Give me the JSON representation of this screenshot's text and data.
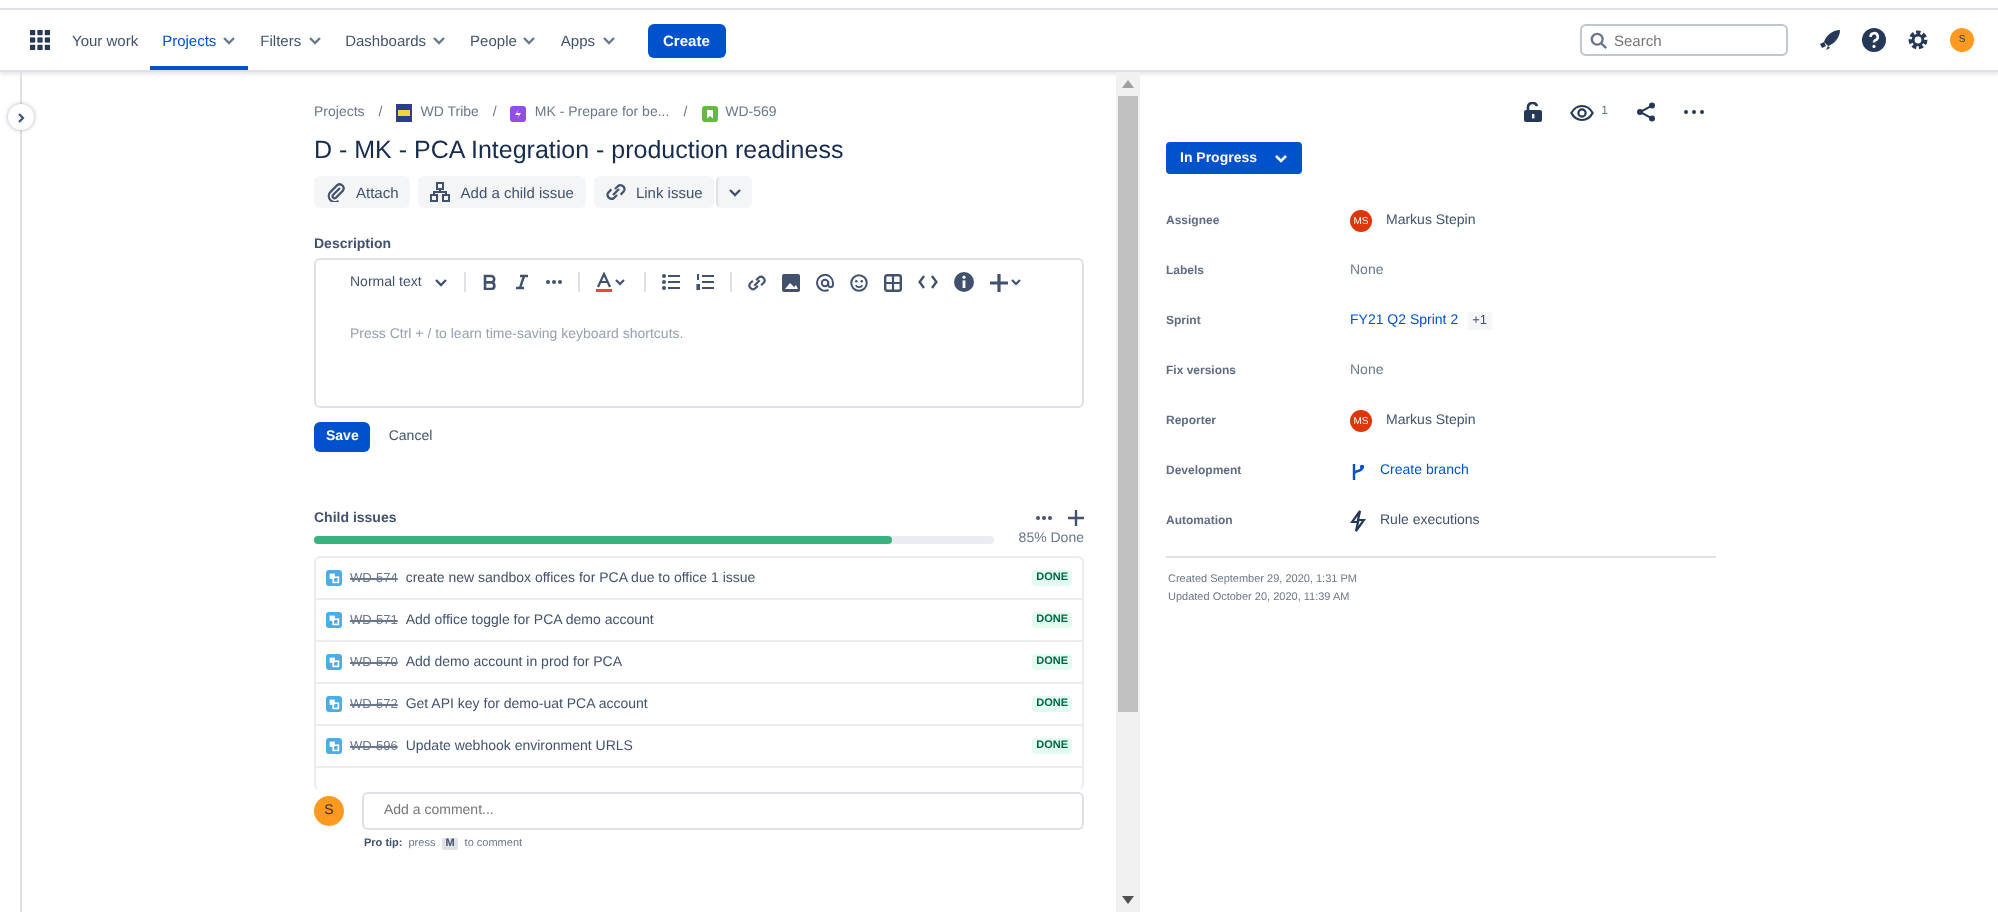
{
  "nav": {
    "items": [
      {
        "label": "Your work",
        "dropdown": false,
        "selected": false
      },
      {
        "label": "Projects",
        "dropdown": true,
        "selected": true
      },
      {
        "label": "Filters",
        "dropdown": true,
        "selected": false
      },
      {
        "label": "Dashboards",
        "dropdown": true,
        "selected": false
      },
      {
        "label": "People",
        "dropdown": true,
        "selected": false
      },
      {
        "label": "Apps",
        "dropdown": true,
        "selected": false
      }
    ],
    "create": "Create",
    "search": {
      "placeholder": "Search"
    },
    "avatar": "S"
  },
  "breadcrumbs": [
    {
      "label": "Projects",
      "kind": "text"
    },
    {
      "label": "WD Tribe",
      "kind": "project",
      "separator": "/"
    },
    {
      "label": "MK - Prepare for be...",
      "kind": "epic",
      "separator": "/"
    },
    {
      "label": "WD-569",
      "kind": "story",
      "separator": "/"
    }
  ],
  "title": "D - MK - PCA Integration - production readiness",
  "actions": [
    {
      "label": "Attach",
      "kind": "attach"
    },
    {
      "label": "Add a child issue",
      "kind": "child"
    },
    {
      "label": "Link issue",
      "kind": "link"
    }
  ],
  "description": {
    "label": "Description",
    "text_style": "Normal text",
    "placeholder": "Press Ctrl + / to learn time-saving keyboard shortcuts.",
    "save": "Save",
    "cancel": "Cancel"
  },
  "child_issues": {
    "title": "Child issues",
    "level": 0.85,
    "progress_text": "85% Done",
    "rows": [
      {
        "key": "WD-574",
        "summary": "create new sandbox offices for PCA due to office 1 issue",
        "status": "DONE",
        "resolved": true
      },
      {
        "key": "WD-571",
        "summary": "Add office toggle for PCA demo account",
        "status": "DONE",
        "resolved": true
      },
      {
        "key": "WD-570",
        "summary": "Add demo account in prod for PCA",
        "status": "DONE",
        "resolved": true
      },
      {
        "key": "WD-572",
        "summary": "Get API key for demo-uat PCA account",
        "status": "DONE",
        "resolved": true
      },
      {
        "key": "WD-596",
        "summary": "Update webhook environment URLS",
        "status": "DONE",
        "resolved": true
      }
    ]
  },
  "comment": {
    "avatar": "S",
    "placeholder": "Add a comment...",
    "tip_label": "Pro tip:",
    "tip_pre": "press",
    "tip_key": "M",
    "tip_post": "to comment"
  },
  "watchers": "1",
  "status": "In Progress",
  "fields": [
    {
      "label": "Assignee",
      "kind": "user",
      "initials": "MS",
      "value": "Markus Stepin"
    },
    {
      "label": "Labels",
      "kind": "none",
      "value": "None"
    },
    {
      "label": "Sprint",
      "kind": "sprint",
      "value": "FY21 Q2 Sprint 2",
      "extra": "+1"
    },
    {
      "label": "Fix versions",
      "kind": "none",
      "value": "None"
    },
    {
      "label": "Reporter",
      "kind": "user",
      "initials": "MS",
      "value": "Markus Stepin"
    },
    {
      "label": "Development",
      "kind": "branch",
      "value": "Create branch"
    },
    {
      "label": "Automation",
      "kind": "automation",
      "value": "Rule executions"
    }
  ],
  "created": "Created September 29, 2020, 1:31 PM",
  "updated": "Updated October 20, 2020, 11:39 AM"
}
